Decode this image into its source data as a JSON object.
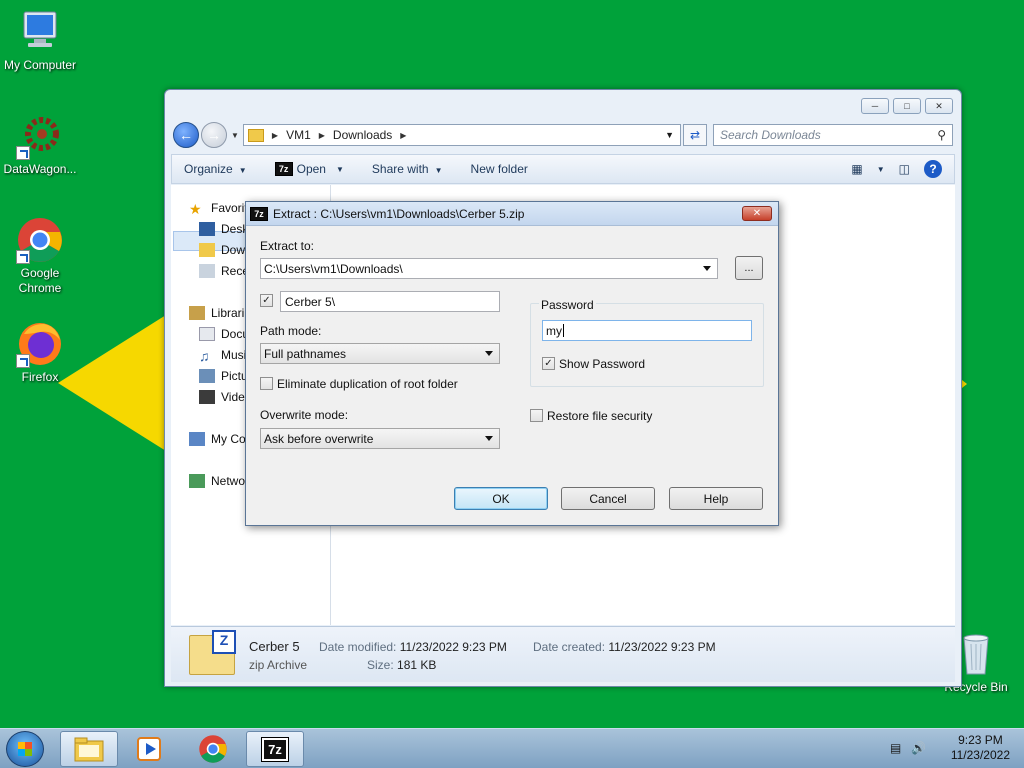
{
  "desktop": {
    "icons": [
      {
        "label": "My Computer"
      },
      {
        "label": "DataWagon..."
      },
      {
        "label": "Google Chrome"
      },
      {
        "label": "Firefox"
      },
      {
        "label": "Recycle Bin"
      }
    ]
  },
  "explorer": {
    "address": {
      "parts": [
        "VM1",
        "Downloads"
      ]
    },
    "search_placeholder": "Search Downloads",
    "toolbar": {
      "organize": "Organize",
      "open": "Open",
      "share_with": "Share with",
      "new_folder": "New folder"
    },
    "nav": [
      {
        "label": "Favorit"
      },
      {
        "label": "Desk"
      },
      {
        "label": "Dow"
      },
      {
        "label": "Rece"
      },
      {
        "label": "Librari"
      },
      {
        "label": "Docu"
      },
      {
        "label": "Musi"
      },
      {
        "label": "Pictu"
      },
      {
        "label": "Vide"
      },
      {
        "label": "My Co"
      },
      {
        "label": "Netwo"
      }
    ],
    "details": {
      "name": "Cerber 5",
      "type": "zip Archive",
      "modified_label": "Date modified:",
      "modified": "11/23/2022 9:23 PM",
      "created_label": "Date created:",
      "created": "11/23/2022 9:23 PM",
      "size_label": "Size:",
      "size": "181 KB"
    }
  },
  "dialog": {
    "title": "Extract : C:\\Users\\vm1\\Downloads\\Cerber 5.zip",
    "extract_to_label": "Extract to:",
    "extract_to_value": "C:\\Users\\vm1\\Downloads\\",
    "browse_label": "...",
    "subfolder_value": "Cerber 5\\",
    "subfolder_checked": true,
    "path_mode_label": "Path mode:",
    "path_mode_value": "Full pathnames",
    "eliminate_dup_label": "Eliminate duplication of root folder",
    "eliminate_dup_checked": false,
    "overwrite_mode_label": "Overwrite mode:",
    "overwrite_mode_value": "Ask before overwrite",
    "password_group_label": "Password",
    "password_value": "my",
    "show_password_label": "Show Password",
    "show_password_checked": true,
    "restore_security_label": "Restore file security",
    "restore_security_checked": false,
    "buttons": {
      "ok": "OK",
      "cancel": "Cancel",
      "help": "Help"
    }
  },
  "taskbar": {
    "time": "9:23 PM",
    "date": "11/23/2022",
    "sevenzip_label": "7z"
  }
}
